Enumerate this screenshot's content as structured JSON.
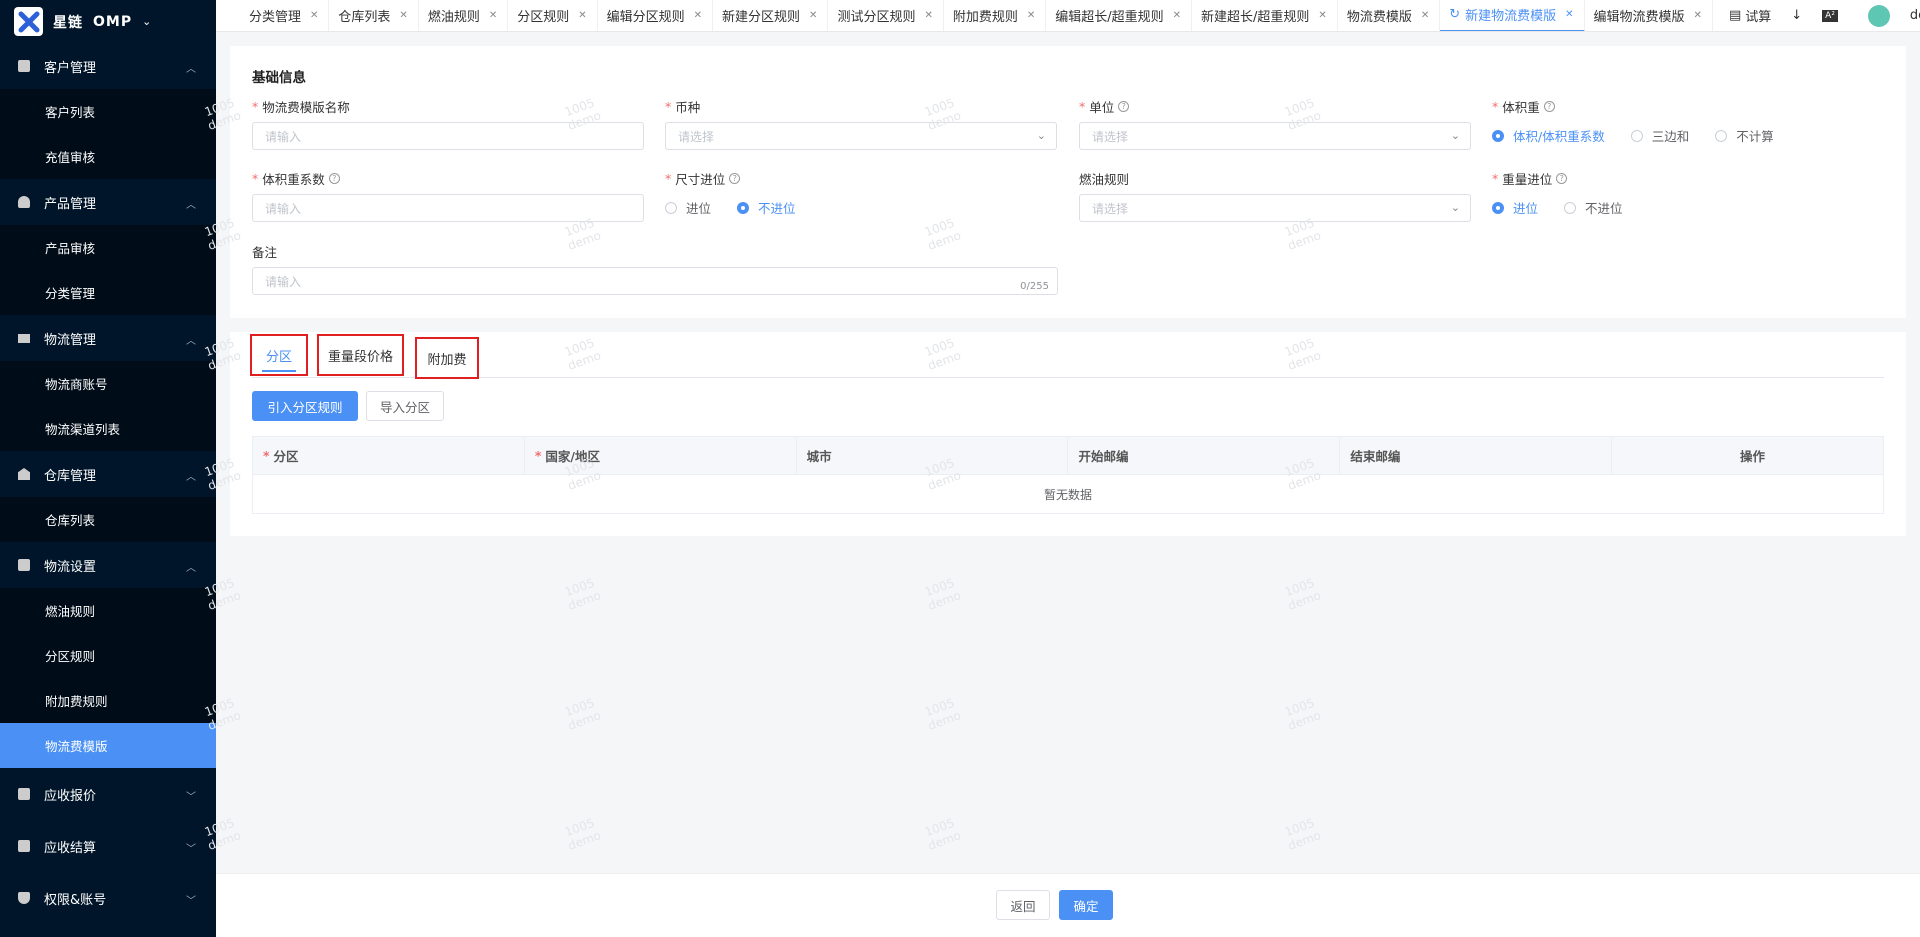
{
  "app": {
    "title": "星链",
    "subtitle": "OMP"
  },
  "sidebar": {
    "groups": [
      {
        "label": "客户管理",
        "items": [
          "客户列表",
          "充值审核"
        ]
      },
      {
        "label": "产品管理",
        "items": [
          "产品审核",
          "分类管理"
        ]
      },
      {
        "label": "物流管理",
        "items": [
          "物流商账号",
          "物流渠道列表"
        ]
      },
      {
        "label": "仓库管理",
        "items": [
          "仓库列表"
        ]
      },
      {
        "label": "物流设置",
        "items": [
          "燃油规则",
          "分区规则",
          "附加费规则",
          "物流费模版"
        ]
      },
      {
        "label": "应收报价",
        "items": []
      },
      {
        "label": "应收结算",
        "items": []
      },
      {
        "label": "权限&账号",
        "items": []
      }
    ]
  },
  "tabs": [
    "分类管理",
    "仓库列表",
    "燃油规则",
    "分区规则",
    "编辑分区规则",
    "新建分区规则",
    "测试分区规则",
    "附加费规则",
    "编辑超长/超重规则",
    "新建超长/超重规则",
    "物流费模版",
    "新建物流费模版",
    "编辑物流费模版"
  ],
  "active_tab": "新建物流费模版",
  "toolbar": {
    "trial": "试算",
    "user": "demo"
  },
  "form": {
    "section_title": "基础信息",
    "template_name": {
      "label": "物流费模版名称",
      "placeholder": "请输入"
    },
    "currency": {
      "label": "币种",
      "placeholder": "请选择"
    },
    "unit": {
      "label": "单位",
      "placeholder": "请选择"
    },
    "vol_weight": {
      "label": "体积重",
      "options": [
        "体积/体积重系数",
        "三边和",
        "不计算"
      ],
      "selected": "体积/体积重系数"
    },
    "vol_coef": {
      "label": "体积重系数",
      "placeholder": "请输入"
    },
    "size_round": {
      "label": "尺寸进位",
      "options": [
        "进位",
        "不进位"
      ],
      "selected": "不进位"
    },
    "fuel_rule": {
      "label": "燃油规则",
      "placeholder": "请选择"
    },
    "weight_round": {
      "label": "重量进位",
      "options": [
        "进位",
        "不进位"
      ],
      "selected": "进位"
    },
    "remark": {
      "label": "备注",
      "placeholder": "请输入",
      "counter": "0/255"
    }
  },
  "subtabs": [
    "分区",
    "重量段价格",
    "附加费"
  ],
  "buttons": {
    "import_rule": "引入分区规则",
    "import_zone": "导入分区",
    "back": "返回",
    "confirm": "确定"
  },
  "table": {
    "columns": [
      "分区",
      "国家/地区",
      "城市",
      "开始邮编",
      "结束邮编",
      "操作"
    ],
    "empty_text": "暂无数据"
  },
  "watermark": {
    "line1": "1005",
    "line2": "demo"
  }
}
